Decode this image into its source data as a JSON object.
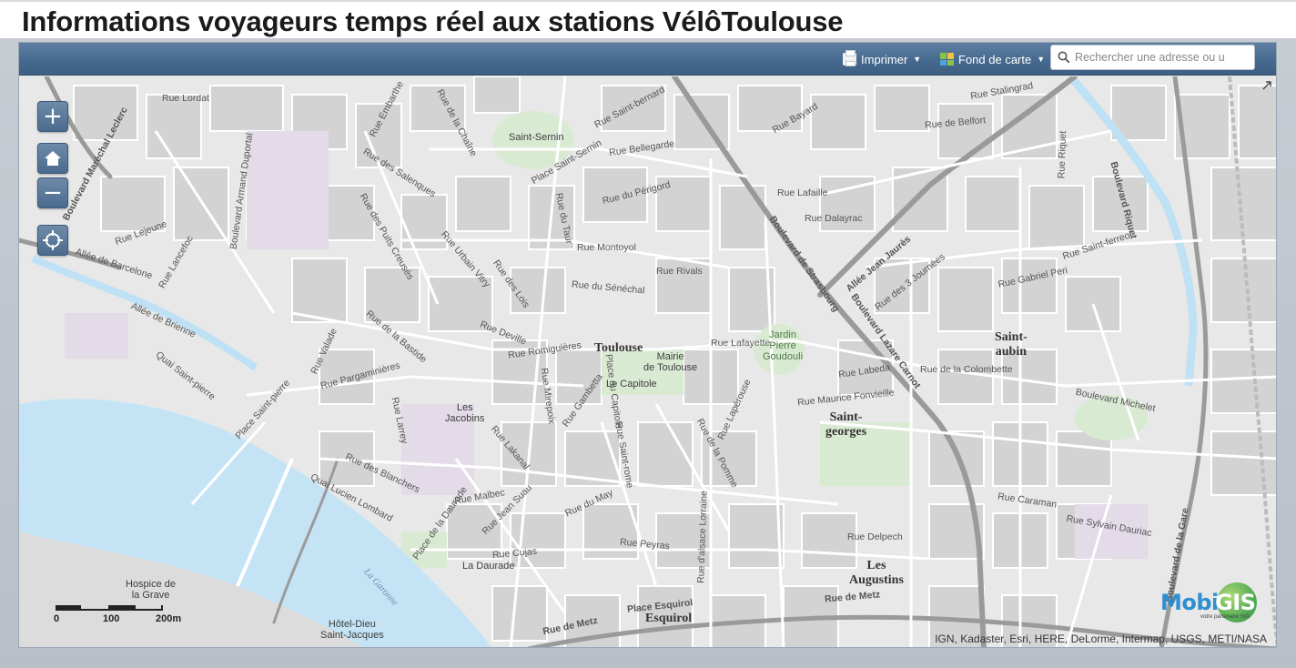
{
  "header": {
    "title": "Informations voyageurs temps réel aux stations VélôToulouse"
  },
  "toolbar": {
    "print_label": "Imprimer",
    "basemap_label": "Fond de carte",
    "search_placeholder": "Rechercher une adresse ou u"
  },
  "map_controls": {
    "zoom_in": "+",
    "zoom_out": "−"
  },
  "map": {
    "places": {
      "toulouse": "Toulouse",
      "saint_aubin_1": "Saint-",
      "saint_aubin_2": "aubin",
      "saint_georges_1": "Saint-",
      "saint_georges_2": "georges",
      "les_augustins_1": "Les",
      "les_augustins_2": "Augustins",
      "esquirol": "Esquirol"
    },
    "pois": {
      "saint_sernin": "Saint-Sernin",
      "mairie_1": "Mairie",
      "mairie_2": "de Toulouse",
      "capitole": "Le Capitole",
      "jacobins_1": "Les",
      "jacobins_2": "Jacobins",
      "jardin_1": "Jardin",
      "jardin_2": "Pierre",
      "jardin_3": "Goudouli",
      "daurade": "La Daurade",
      "hospice_1": "Hospice de",
      "hospice_2": "la Grave",
      "hotel_dieu_1": "Hôtel-Dieu",
      "hotel_dieu_2": "Saint-Jacques"
    },
    "water": {
      "garonne": "La Garonne"
    },
    "streets": {
      "lordat": "Rue Lordat",
      "embarthe": "Rue Embarthe",
      "chaine": "Rue de la Chaîne",
      "saint_bernard": "Rue Saint-bernard",
      "bellegarde": "Rue Bellegarde",
      "place_saint_sernin": "Place Saint-Sernin",
      "perigord": "Rue du Périgord",
      "taur": "Rue du Taur",
      "montoyol": "Rue Montoyol",
      "rivals": "Rue Rivals",
      "senechal": "Rue du Sénéchal",
      "salenques": "Rue des Salenques",
      "puits_creuses": "Rue des Puits Creusés",
      "urbain_vitry": "Rue Urbain Vitry",
      "lois": "Rue des Lois",
      "deville": "Rue Deville",
      "bastide": "Rue de la Bastide",
      "lejeune": "Rue Lejeune",
      "lancefoc": "Rue Lancefoc",
      "allee_barcelone": "Allée de Barcelone",
      "allee_brienne": "Allée de Brienne",
      "bd_marechal_leclerc": "Boulevard Maréchal Leclerc",
      "bd_armand_duportal": "Boulevard Armand Duportal",
      "quai_saint_pierre": "Quai Saint-pierre",
      "place_saint_pierre": "Place Saint-pierre",
      "pargaminieres": "Rue Pargaminières",
      "romiguieres": "Rue Romiguières",
      "valade": "Rue Valade",
      "larrey": "Rue Larrey",
      "mirepoix": "Rue Mirepoix",
      "gambetta": "Rue Gambetta",
      "place_capitole": "Place du Capitole",
      "saint_rome": "Rue Saint-rome",
      "lakanal": "Rue Lakanal",
      "blanchers": "Rue des Blanchers",
      "quai_lombard": "Quai Lucien Lombard",
      "malbec": "Rue Malbec",
      "jean_suau": "Rue Jean Suau",
      "place_daurade": "Place de la Daurade",
      "cujas": "Rue Cujas",
      "peyras": "Rue Peyras",
      "rue_du_may": "Rue du May",
      "pomme": "Rue de la Pomme",
      "alsace": "Rue d'alsace Lorraine",
      "lafayette": "Rue Lafayette",
      "laperouse": "Rue Lapérouse",
      "place_esquirol": "Place Esquirol",
      "rue_de_metz": "Rue de Metz",
      "bayard": "Rue Bayard",
      "lafaille": "Rue Lafaille",
      "dalayrac": "Rue Dalayrac",
      "bd_strasbourg": "Boulevard de Strasbourg",
      "bd_lazare_carnot": "Boulevard Lazare Carnot",
      "allee_jean_jaures": "Allée Jean Jaurès",
      "trois_journees": "Rue des 3 Journées",
      "stalingrad": "Rue Stalingrad",
      "belfort": "Rue de Belfort",
      "saint_ferreol": "Rue Saint-ferreol",
      "gabriel_peri": "Rue Gabriel Peri",
      "labeda": "Rue Labeda",
      "colombette": "Rue de la Colombette",
      "maurice_fonvieille": "Rue Maurice Fonvieille",
      "bd_michelet": "Boulevard Michelet",
      "caraman": "Rue Caraman",
      "sylvain_dauriac": "Rue Sylvain Dauriac",
      "delpech": "Rue Delpech",
      "bd_riquet": "Boulevard Riquet",
      "bd_de_la_gare": "Boulevard de la Gare",
      "metz_east": "Rue de Metz",
      "remusat": "Rue Riquet"
    }
  },
  "scale": {
    "ticks": [
      "0",
      "100",
      "200m"
    ]
  },
  "attribution": "IGN, Kadaster, Esri, HERE, DeLorme, Intermap, USGS, METI/NASA",
  "logo": {
    "text_left": "Mobi",
    "text_right": "GIS",
    "subtitle": "votre partenaire SIG"
  },
  "colors": {
    "toolbar": "#4b6d92",
    "water": "#bfe1f5",
    "map_bg": "#e8e8e8",
    "blocks": "#d2d2d2",
    "parks": "#d7ead0"
  }
}
